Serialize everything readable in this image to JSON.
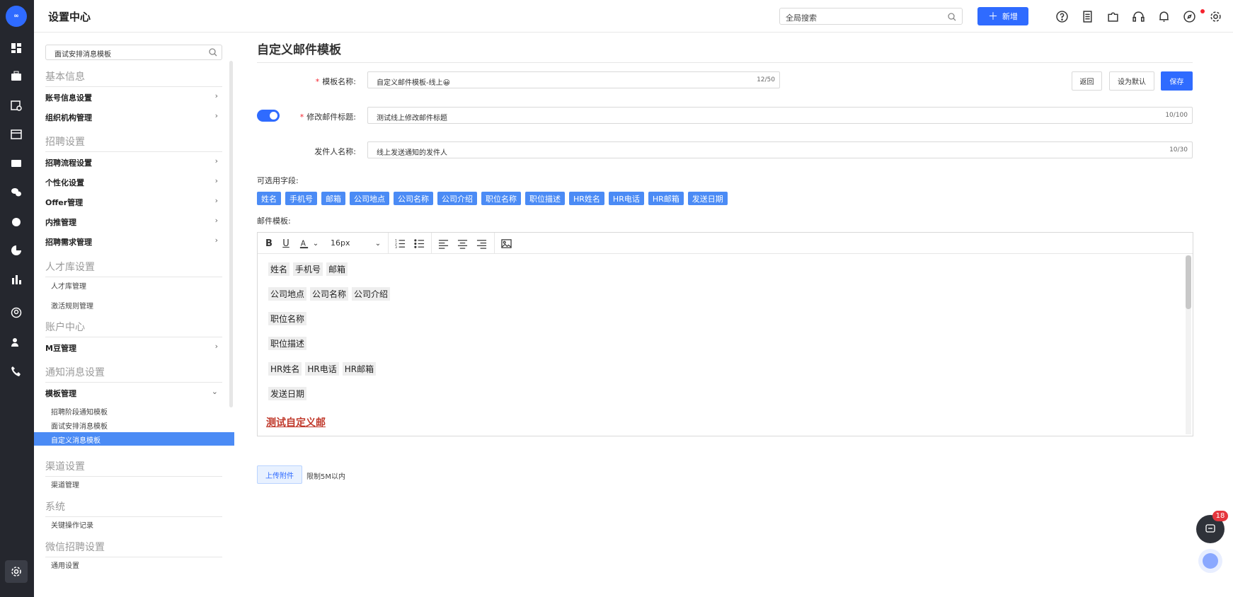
{
  "app": {
    "title": "设置中心",
    "logo_text": "∞"
  },
  "topbar": {
    "search_placeholder": "全局搜索",
    "new_label": "新增"
  },
  "sidebar": {
    "search_value": "面试安排消息模板",
    "sections": {
      "basic": "基本信息",
      "recruit": "招聘设置",
      "talent": "人才库设置",
      "account": "账户中心",
      "notify": "通知消息设置",
      "channel": "渠道设置",
      "system": "系统",
      "wechat": "微信招聘设置"
    },
    "items": {
      "account_info": "账号信息设置",
      "org": "组织机构管理",
      "process": "招聘流程设置",
      "personal": "个性化设置",
      "offer": "Offer管理",
      "referral": "内推管理",
      "demand": "招聘需求管理",
      "mbean": "M豆管理",
      "template": "模板管理"
    },
    "subs": {
      "talent_manage": "人才库管理",
      "activate": "激活规则管理",
      "stage_notice": "招聘阶段通知模板",
      "interview_msg": "面试安排消息模板",
      "custom_msg": "自定义消息模板",
      "channel_manage": "渠道管理",
      "key_log": "关键操作记录",
      "general": "通用设置"
    },
    "chevron": "›",
    "chevron_down": "⌄"
  },
  "main": {
    "page_title": "自定义邮件模板",
    "template_name_label": "模板名称:",
    "template_name_value": "自定义邮件模板-线上😀",
    "template_name_count": "12/50",
    "subject_label": "修改邮件标题:",
    "subject_value": "测试线上修改邮件标题",
    "subject_count": "10/100",
    "sender_label": "发件人名称:",
    "sender_value": "线上发送通知的发件人",
    "sender_count": "10/30",
    "buttons": {
      "back": "返回",
      "set_default": "设为默认",
      "save": "保存"
    },
    "fields_label": "可选用字段:",
    "tags": [
      "姓名",
      "手机号",
      "邮箱",
      "公司地点",
      "公司名称",
      "公司介绍",
      "职位名称",
      "职位描述",
      "HR姓名",
      "HR电话",
      "HR邮箱",
      "发送日期"
    ],
    "template_label": "邮件模板:",
    "editor": {
      "font_size": "16px",
      "lines": [
        [
          "姓名",
          "手机号",
          "邮箱"
        ],
        [
          "公司地点",
          "公司名称",
          "公司介绍"
        ],
        [
          "职位名称"
        ],
        [
          "职位描述"
        ],
        [
          "HR姓名",
          "HR电话",
          "HR邮箱"
        ],
        [
          "发送日期"
        ]
      ],
      "link_text": "测试自定义邮"
    },
    "upload_label": "上传附件",
    "limit_text": "限制5M以内"
  },
  "chat": {
    "badge": "18"
  }
}
